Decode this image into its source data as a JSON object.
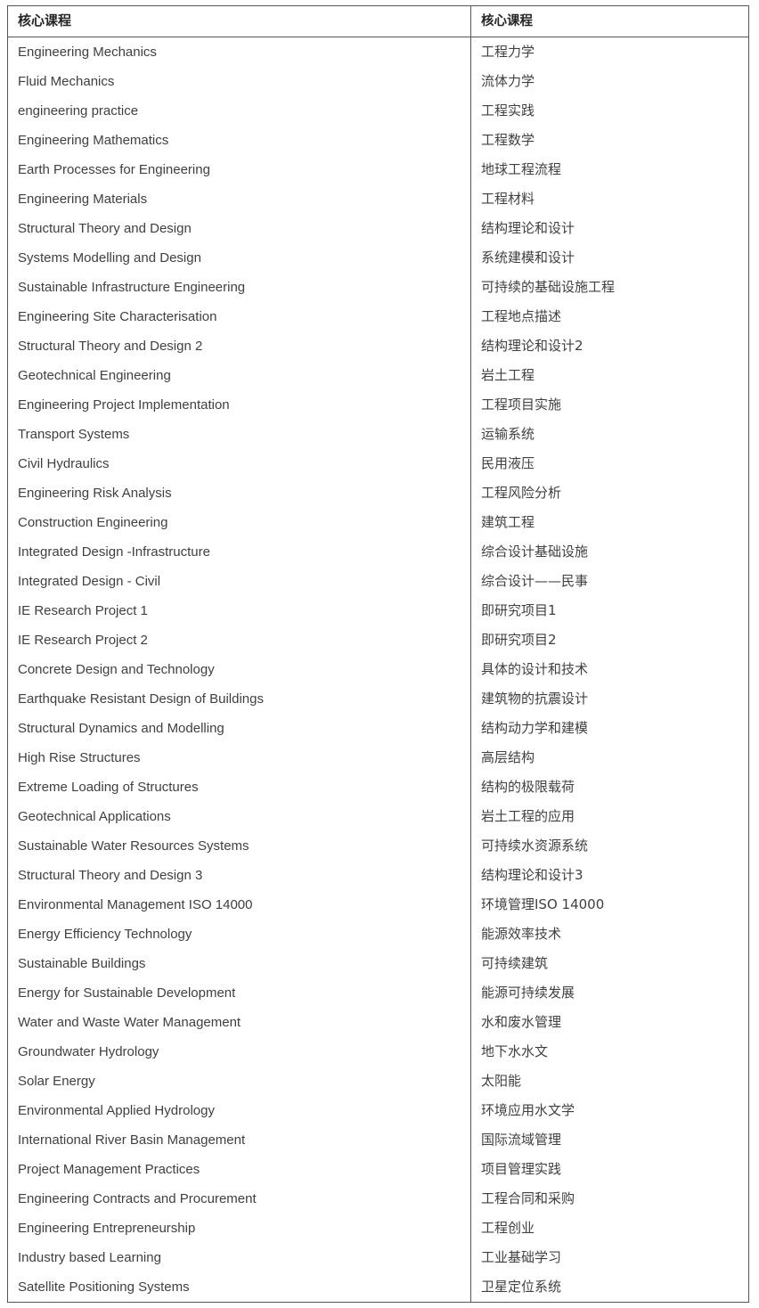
{
  "table": {
    "headers": {
      "english_column": "核心课程",
      "chinese_column": "核心课程"
    },
    "rows": [
      {
        "english": "Engineering Mechanics",
        "chinese": "工程力学"
      },
      {
        "english": "Fluid Mechanics",
        "chinese": "流体力学"
      },
      {
        "english": "engineering practice",
        "chinese": "工程实践"
      },
      {
        "english": "Engineering Mathematics",
        "chinese": "工程数学"
      },
      {
        "english": "Earth Processes for Engineering",
        "chinese": "地球工程流程"
      },
      {
        "english": "Engineering Materials",
        "chinese": "工程材料"
      },
      {
        "english": "Structural Theory and Design",
        "chinese": "结构理论和设计"
      },
      {
        "english": "Systems Modelling and Design",
        "chinese": "系统建模和设计"
      },
      {
        "english": "Sustainable Infrastructure Engineering",
        "chinese": "可持续的基础设施工程"
      },
      {
        "english": "Engineering Site Characterisation",
        "chinese": "工程地点描述"
      },
      {
        "english": "Structural Theory and Design 2",
        "chinese": "结构理论和设计2"
      },
      {
        "english": "Geotechnical Engineering",
        "chinese": "岩土工程"
      },
      {
        "english": "Engineering Project Implementation",
        "chinese": "工程项目实施"
      },
      {
        "english": "Transport Systems",
        "chinese": "运输系统"
      },
      {
        "english": "Civil Hydraulics",
        "chinese": "民用液压"
      },
      {
        "english": "Engineering Risk Analysis",
        "chinese": "工程风险分析"
      },
      {
        "english": "Construction Engineering",
        "chinese": "建筑工程"
      },
      {
        "english": "Integrated Design -Infrastructure",
        "chinese": "综合设计基础设施"
      },
      {
        "english": "Integrated Design - Civil",
        "chinese": "综合设计——民事"
      },
      {
        "english": "IE Research Project 1",
        "chinese": "即研究项目1"
      },
      {
        "english": "IE Research Project 2",
        "chinese": "即研究项目2"
      },
      {
        "english": "Concrete Design and Technology",
        "chinese": "具体的设计和技术"
      },
      {
        "english": "Earthquake Resistant Design of Buildings",
        "chinese": "建筑物的抗震设计"
      },
      {
        "english": "Structural Dynamics and Modelling",
        "chinese": "结构动力学和建模"
      },
      {
        "english": "High Rise Structures",
        "chinese": "高层结构"
      },
      {
        "english": "Extreme Loading of Structures",
        "chinese": "结构的极限载荷"
      },
      {
        "english": "Geotechnical Applications",
        "chinese": "岩土工程的应用"
      },
      {
        "english": "Sustainable Water Resources Systems",
        "chinese": "可持续水资源系统"
      },
      {
        "english": "Structural Theory and Design 3",
        "chinese": "结构理论和设计3"
      },
      {
        "english": "Environmental Management ISO 14000",
        "chinese": "环境管理ISO 14000"
      },
      {
        "english": "Energy Efficiency Technology",
        "chinese": "能源效率技术"
      },
      {
        "english": "Sustainable Buildings",
        "chinese": "可持续建筑"
      },
      {
        "english": "Energy for Sustainable Development",
        "chinese": "能源可持续发展"
      },
      {
        "english": "Water and Waste Water Management",
        "chinese": "水和废水管理"
      },
      {
        "english": "Groundwater Hydrology",
        "chinese": "地下水水文"
      },
      {
        "english": "Solar Energy",
        "chinese": "太阳能"
      },
      {
        "english": "Environmental Applied Hydrology",
        "chinese": "环境应用水文学"
      },
      {
        "english": "International River Basin Management",
        "chinese": "国际流域管理"
      },
      {
        "english": "Project Management Practices",
        "chinese": "项目管理实践"
      },
      {
        "english": "Engineering Contracts and Procurement",
        "chinese": "工程合同和采购"
      },
      {
        "english": "Engineering Entrepreneurship",
        "chinese": "工程创业"
      },
      {
        "english": "Industry based Learning",
        "chinese": "工业基础学习"
      },
      {
        "english": "Satellite Positioning Systems",
        "chinese": "卫星定位系统"
      }
    ]
  },
  "style": {
    "border_color": "#555555",
    "text_color": "#404040",
    "header_text_color": "#262626",
    "background_color": "#ffffff"
  }
}
